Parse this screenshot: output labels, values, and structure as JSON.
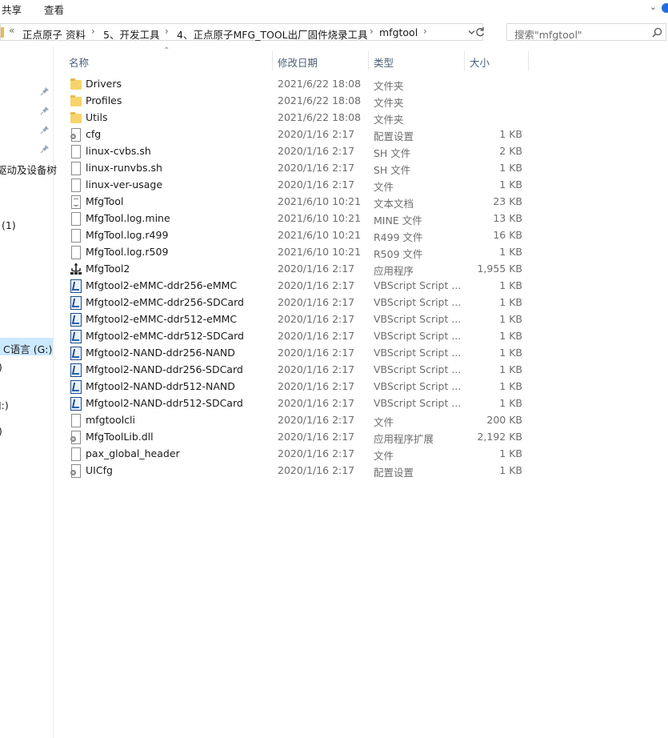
{
  "ribbon": {
    "tabs": [
      "共享",
      "查看"
    ]
  },
  "address": {
    "overflow": "«",
    "segments": [
      "正点原子 资料",
      "5、开发工具",
      "4、正点原子MFG_TOOL出厂固件烧录工具",
      "mfgtool"
    ],
    "separator": "›"
  },
  "search": {
    "placeholder": "搜索\"mfgtool\""
  },
  "nav": {
    "items": [
      "驱动及设备树",
      "(1)",
      "C语言 (G:)",
      ")",
      "J:)",
      ")"
    ]
  },
  "columns": {
    "name": "名称",
    "date": "修改日期",
    "type": "类型",
    "size": "大小"
  },
  "files": [
    {
      "name": "Drivers",
      "date": "2021/6/22 18:08",
      "type": "文件夹",
      "size": "",
      "icon": "folder-icon"
    },
    {
      "name": "Profiles",
      "date": "2021/6/22 18:08",
      "type": "文件夹",
      "size": "",
      "icon": "folder-icon"
    },
    {
      "name": "Utils",
      "date": "2021/6/22 18:08",
      "type": "文件夹",
      "size": "",
      "icon": "folder-icon"
    },
    {
      "name": "cfg",
      "date": "2020/1/16 2:17",
      "type": "配置设置",
      "size": "1 KB",
      "icon": "config-file-icon"
    },
    {
      "name": "linux-cvbs.sh",
      "date": "2020/1/16 2:17",
      "type": "SH 文件",
      "size": "2 KB",
      "icon": "file-icon"
    },
    {
      "name": "linux-runvbs.sh",
      "date": "2020/1/16 2:17",
      "type": "SH 文件",
      "size": "1 KB",
      "icon": "file-icon"
    },
    {
      "name": "linux-ver-usage",
      "date": "2020/1/16 2:17",
      "type": "文件",
      "size": "1 KB",
      "icon": "file-icon"
    },
    {
      "name": "MfgTool",
      "date": "2021/6/10 10:21",
      "type": "文本文档",
      "size": "23 KB",
      "icon": "text-file-icon"
    },
    {
      "name": "MfgTool.log.mine",
      "date": "2021/6/10 10:21",
      "type": "MINE 文件",
      "size": "13 KB",
      "icon": "file-icon"
    },
    {
      "name": "MfgTool.log.r499",
      "date": "2021/6/10 10:21",
      "type": "R499 文件",
      "size": "16 KB",
      "icon": "file-icon"
    },
    {
      "name": "MfgTool.log.r509",
      "date": "2021/6/10 10:21",
      "type": "R509 文件",
      "size": "1 KB",
      "icon": "file-icon"
    },
    {
      "name": "MfgTool2",
      "date": "2020/1/16 2:17",
      "type": "应用程序",
      "size": "1,955 KB",
      "icon": "usb-app-icon"
    },
    {
      "name": "Mfgtool2-eMMC-ddr256-eMMC",
      "date": "2020/1/16 2:17",
      "type": "VBScript Script ...",
      "size": "1 KB",
      "icon": "vbscript-icon"
    },
    {
      "name": "Mfgtool2-eMMC-ddr256-SDCard",
      "date": "2020/1/16 2:17",
      "type": "VBScript Script ...",
      "size": "1 KB",
      "icon": "vbscript-icon"
    },
    {
      "name": "Mfgtool2-eMMC-ddr512-eMMC",
      "date": "2020/1/16 2:17",
      "type": "VBScript Script ...",
      "size": "1 KB",
      "icon": "vbscript-icon"
    },
    {
      "name": "Mfgtool2-eMMC-ddr512-SDCard",
      "date": "2020/1/16 2:17",
      "type": "VBScript Script ...",
      "size": "1 KB",
      "icon": "vbscript-icon"
    },
    {
      "name": "Mfgtool2-NAND-ddr256-NAND",
      "date": "2020/1/16 2:17",
      "type": "VBScript Script ...",
      "size": "1 KB",
      "icon": "vbscript-icon"
    },
    {
      "name": "Mfgtool2-NAND-ddr256-SDCard",
      "date": "2020/1/16 2:17",
      "type": "VBScript Script ...",
      "size": "1 KB",
      "icon": "vbscript-icon"
    },
    {
      "name": "Mfgtool2-NAND-ddr512-NAND",
      "date": "2020/1/16 2:17",
      "type": "VBScript Script ...",
      "size": "1 KB",
      "icon": "vbscript-icon"
    },
    {
      "name": "Mfgtool2-NAND-ddr512-SDCard",
      "date": "2020/1/16 2:17",
      "type": "VBScript Script ...",
      "size": "1 KB",
      "icon": "vbscript-icon"
    },
    {
      "name": "mfgtoolcli",
      "date": "2020/1/16 2:17",
      "type": "文件",
      "size": "200 KB",
      "icon": "file-icon"
    },
    {
      "name": "MfgToolLib.dll",
      "date": "2020/1/16 2:17",
      "type": "应用程序扩展",
      "size": "2,192 KB",
      "icon": "dll-file-icon"
    },
    {
      "name": "pax_global_header",
      "date": "2020/1/16 2:17",
      "type": "文件",
      "size": "1 KB",
      "icon": "file-icon"
    },
    {
      "name": "UICfg",
      "date": "2020/1/16 2:17",
      "type": "配置设置",
      "size": "1 KB",
      "icon": "config-file-icon"
    }
  ],
  "colors": {
    "selection": "#cce8ff",
    "header_text": "#4c607a",
    "folder": "#f7d46b",
    "vbscript": "#1e4d8c"
  }
}
